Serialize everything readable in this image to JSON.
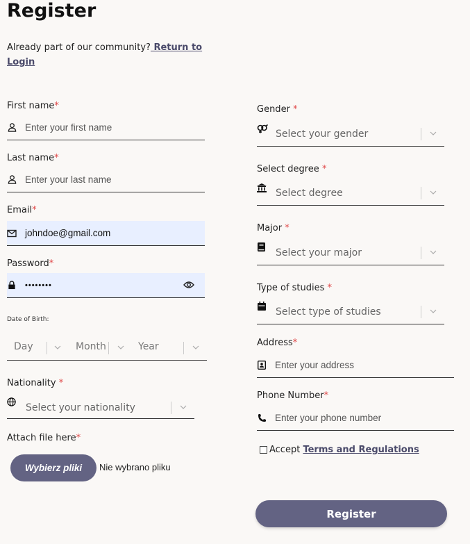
{
  "title": "Register",
  "intro": {
    "text": "Already part of our community?",
    "link": " Return to Login"
  },
  "left": {
    "first_name": {
      "label": "First name",
      "placeholder": "Enter your first name"
    },
    "last_name": {
      "label": "Last name",
      "placeholder": "Enter your last name"
    },
    "email": {
      "label": "Email",
      "value": "johndoe@gmail.com"
    },
    "password": {
      "label": "Password",
      "value": "••••••••"
    },
    "dob": {
      "label": "Date of Birth:",
      "day": "Day",
      "month": "Month",
      "year": "Year"
    },
    "nationality": {
      "label": "Nationality",
      "placeholder": "Select your nationality"
    },
    "attach": {
      "label": "Attach file here",
      "button": "Wybierz pliki",
      "status": "Nie wybrano pliku"
    }
  },
  "right": {
    "gender": {
      "label": "Gender",
      "placeholder": "Select your gender"
    },
    "degree": {
      "label": "Select degree",
      "placeholder": "Select degree"
    },
    "major": {
      "label": "Major",
      "placeholder": "Select your major"
    },
    "studies": {
      "label": "Type of studies",
      "placeholder": "Select type of studies"
    },
    "address": {
      "label": "Address",
      "placeholder": "Enter your address"
    },
    "phone": {
      "label": "Phone Number",
      "placeholder": "Enter your phone number"
    },
    "accept": {
      "text": "Accept ",
      "link": "Terms and Regulations"
    }
  },
  "required_mark": "*",
  "submit_label": "Register",
  "colors": {
    "accent": "#636383",
    "required": "#e04848",
    "filled_bg": "#e8efff",
    "background": "#faf8f6"
  }
}
